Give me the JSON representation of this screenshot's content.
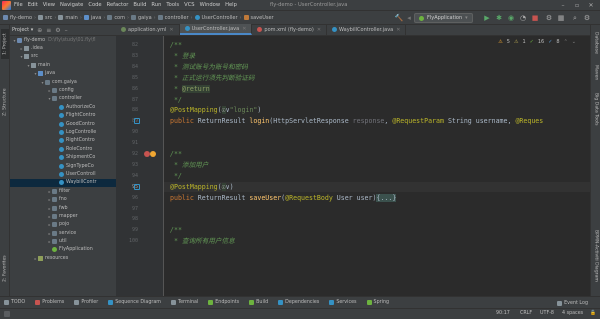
{
  "menubar": {
    "items": [
      "File",
      "Edit",
      "View",
      "Navigate",
      "Code",
      "Refactor",
      "Build",
      "Run",
      "Tools",
      "VCS",
      "Window",
      "Help"
    ],
    "title": "fly-demo - UserController.java"
  },
  "breadcrumb": [
    "fly-demo",
    "src",
    "main",
    "java",
    "com",
    "gaiya",
    "controller",
    "UserController",
    "saveUser"
  ],
  "run_config": "FlyApplication",
  "project_panel": {
    "title": "Project",
    "root_label": "fly-demo",
    "root_path": "D:\\fly\\study\\01.fly\\fl",
    "rows": [
      {
        "label": "fly-demo",
        "depth": 0,
        "icon": "module",
        "arrow": "▾",
        "sub": "D:\\fly\\study\\01.fly\\fl"
      },
      {
        "label": ".idea",
        "depth": 1,
        "icon": "folder",
        "arrow": "▸"
      },
      {
        "label": "src",
        "depth": 1,
        "icon": "folder",
        "arrow": "▾"
      },
      {
        "label": "main",
        "depth": 2,
        "icon": "folder",
        "arrow": "▾"
      },
      {
        "label": "java",
        "depth": 3,
        "icon": "folder src",
        "arrow": "▾"
      },
      {
        "label": "com.gaiya",
        "depth": 4,
        "icon": "pkg",
        "arrow": "▾"
      },
      {
        "label": "config",
        "depth": 5,
        "icon": "pkg",
        "arrow": "▸"
      },
      {
        "label": "controller",
        "depth": 5,
        "icon": "pkg",
        "arrow": "▾"
      },
      {
        "label": "AuthorizeCo",
        "depth": 6,
        "icon": "cls",
        "arrow": ""
      },
      {
        "label": "FlightContro",
        "depth": 6,
        "icon": "cls",
        "arrow": ""
      },
      {
        "label": "GoodContro",
        "depth": 6,
        "icon": "cls",
        "arrow": ""
      },
      {
        "label": "LogControlle",
        "depth": 6,
        "icon": "cls",
        "arrow": ""
      },
      {
        "label": "RightContro",
        "depth": 6,
        "icon": "cls",
        "arrow": ""
      },
      {
        "label": "RoleContro",
        "depth": 6,
        "icon": "cls",
        "arrow": ""
      },
      {
        "label": "ShipmentCo",
        "depth": 6,
        "icon": "cls",
        "arrow": ""
      },
      {
        "label": "SignTypeCo",
        "depth": 6,
        "icon": "cls",
        "arrow": ""
      },
      {
        "label": "UserControll",
        "depth": 6,
        "icon": "cls",
        "arrow": ""
      },
      {
        "label": "WaybillContr",
        "depth": 6,
        "icon": "cls",
        "arrow": "",
        "selected": true
      },
      {
        "label": "filter",
        "depth": 5,
        "icon": "pkg",
        "arrow": "▸"
      },
      {
        "label": "fno",
        "depth": 5,
        "icon": "pkg",
        "arrow": "▸"
      },
      {
        "label": "fwb",
        "depth": 5,
        "icon": "pkg",
        "arrow": "▸"
      },
      {
        "label": "mapper",
        "depth": 5,
        "icon": "pkg",
        "arrow": "▸"
      },
      {
        "label": "pojo",
        "depth": 5,
        "icon": "pkg",
        "arrow": "▸"
      },
      {
        "label": "service",
        "depth": 5,
        "icon": "pkg",
        "arrow": "▸"
      },
      {
        "label": "util",
        "depth": 5,
        "icon": "pkg",
        "arrow": "▸"
      },
      {
        "label": "FlyApplication",
        "depth": 5,
        "icon": "spring",
        "arrow": ""
      },
      {
        "label": "resources",
        "depth": 3,
        "icon": "folder res",
        "arrow": "▸"
      }
    ]
  },
  "left_stripe": [
    "1: Project",
    "Z: Structure",
    "2: Favorites"
  ],
  "right_stripe": [
    "Database",
    "Maven",
    "Big Data Tools",
    "BPMN-Activiti Diagram"
  ],
  "tabs": [
    {
      "label": "application.yml",
      "active": false,
      "color": "#6a8759"
    },
    {
      "label": "UserController.java",
      "active": true,
      "color": "#3592c4"
    },
    {
      "label": "pom.xml (fly-demo)",
      "active": false,
      "color": "#c75450"
    },
    {
      "label": "WaybillController.java",
      "active": false,
      "color": "#3592c4"
    }
  ],
  "inspection": {
    "warnings": "5",
    "weak": "1",
    "typos": "16",
    "hints": "8"
  },
  "code_lines": [
    {
      "num": "82",
      "segments": [
        [
          "doc",
          "/**"
        ]
      ]
    },
    {
      "num": "83",
      "segments": [
        [
          "doc",
          " * 登录"
        ]
      ]
    },
    {
      "num": "84",
      "segments": [
        [
          "doc",
          " * 测试账号为账号和密码"
        ]
      ]
    },
    {
      "num": "85",
      "segments": [
        [
          "doc",
          " * 正式运行须先判断验证码"
        ]
      ]
    },
    {
      "num": "86",
      "segments": [
        [
          "doc",
          " * "
        ],
        [
          "doctag",
          "@return"
        ]
      ]
    },
    {
      "num": "87",
      "segments": [
        [
          "doc",
          " */"
        ]
      ]
    },
    {
      "num": "88",
      "segments": [
        [
          "ann",
          "@PostMapping"
        ],
        [
          "plain",
          "("
        ],
        [
          "hl",
          "☉"
        ],
        [
          "plain",
          "∨"
        ],
        [
          "str",
          "\"login\""
        ],
        [
          "plain",
          ")"
        ]
      ]
    },
    {
      "num": "89",
      "segments": [
        [
          "kw",
          "public "
        ],
        [
          "plain",
          "ReturnResult "
        ],
        [
          "fn",
          "login"
        ],
        [
          "plain",
          "(HttpServletResponse "
        ],
        [
          "param",
          "response"
        ],
        [
          "plain",
          ", "
        ],
        [
          "ann",
          "@RequestParam "
        ],
        [
          "plain",
          "String username, "
        ],
        [
          "ann",
          "@Reques"
        ]
      ]
    },
    {
      "num": "90",
      "segments": []
    },
    {
      "num": "91",
      "segments": []
    },
    {
      "num": "92",
      "segments": [
        [
          "doc",
          "/**"
        ]
      ]
    },
    {
      "num": "93",
      "segments": [
        [
          "doc",
          " * 添加用户"
        ]
      ]
    },
    {
      "num": "94",
      "segments": [
        [
          "doc",
          " */"
        ]
      ]
    },
    {
      "num": "95",
      "segments": [
        [
          "ann",
          "@PostMapping"
        ],
        [
          "plain",
          "("
        ],
        [
          "hl",
          "☉"
        ],
        [
          "plain",
          "∨)"
        ]
      ]
    },
    {
      "num": "96",
      "segments": [
        [
          "kw",
          "public "
        ],
        [
          "plain",
          "ReturnResult "
        ],
        [
          "fn",
          "saveUser"
        ],
        [
          "plain",
          "("
        ],
        [
          "ann",
          "@RequestBody "
        ],
        [
          "plain",
          "User user)"
        ],
        [
          "fold",
          "{...}"
        ]
      ]
    },
    {
      "num": "97",
      "segments": []
    },
    {
      "num": "98",
      "segments": []
    },
    {
      "num": "99",
      "segments": [
        [
          "doc",
          "/**"
        ]
      ]
    },
    {
      "num": "100",
      "segments": [
        [
          "doc",
          " * 查询所有用户信息"
        ]
      ]
    }
  ],
  "bottom_tools": [
    {
      "label": "TODO",
      "color": "#87939a"
    },
    {
      "label": "Problems",
      "color": "#c75450"
    },
    {
      "label": "Profiler",
      "color": "#87939a"
    },
    {
      "label": "Sequence Diagram",
      "color": "#3592c4"
    },
    {
      "label": "Terminal",
      "color": "#87939a"
    },
    {
      "label": "Endpoints",
      "color": "#6db33f"
    },
    {
      "label": "Build",
      "color": "#6db33f"
    },
    {
      "label": "Dependencies",
      "color": "#3592c4"
    },
    {
      "label": "Services",
      "color": "#3592c4"
    },
    {
      "label": "Spring",
      "color": "#6db33f"
    }
  ],
  "event_log": "Event Log",
  "status": {
    "position": "90:17",
    "line_sep": "CRLF",
    "encoding": "UTF-8",
    "indent": "4 spaces"
  }
}
